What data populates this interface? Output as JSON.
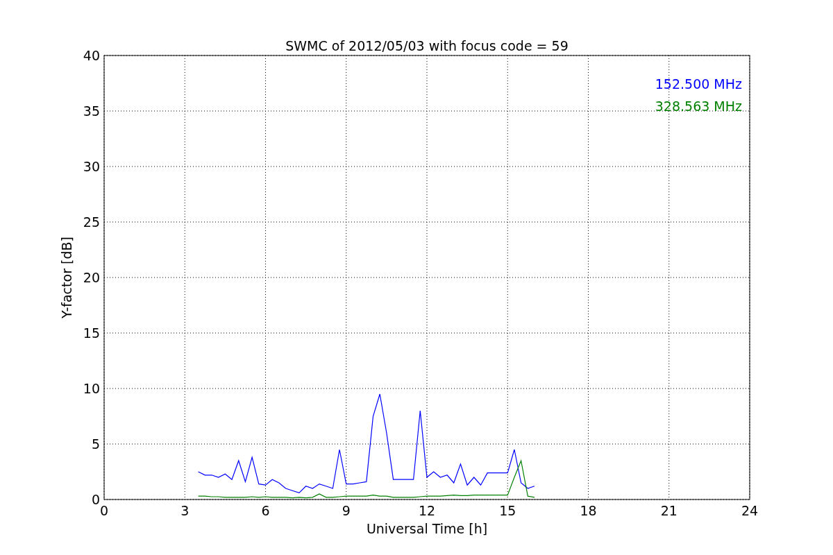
{
  "chart_data": {
    "type": "line",
    "title": "SWMC of 2012/05/03 with focus code = 59",
    "xlabel": "Universal Time [h]",
    "ylabel": "Y-factor [dB]",
    "x": [
      3.5,
      3.75,
      4.0,
      4.25,
      4.5,
      4.75,
      5.0,
      5.25,
      5.5,
      5.75,
      6.0,
      6.25,
      6.5,
      6.75,
      7.0,
      7.25,
      7.5,
      7.75,
      8.0,
      8.25,
      8.5,
      8.75,
      9.0,
      9.25,
      9.5,
      9.75,
      10.0,
      10.25,
      10.5,
      10.75,
      11.0,
      11.25,
      11.5,
      11.75,
      12.0,
      12.25,
      12.5,
      12.75,
      13.0,
      13.25,
      13.5,
      13.75,
      14.0,
      14.25,
      14.5,
      14.75,
      15.0,
      15.25,
      15.5,
      15.75,
      16.0
    ],
    "series": [
      {
        "name": "152.500 MHz",
        "color": "#0000ff",
        "values": [
          2.5,
          2.2,
          2.2,
          2.0,
          2.3,
          1.8,
          3.5,
          1.6,
          3.8,
          1.4,
          1.3,
          1.8,
          1.5,
          1.0,
          0.8,
          0.6,
          1.2,
          1.0,
          1.4,
          1.2,
          1.0,
          4.5,
          1.4,
          1.4,
          1.5,
          1.6,
          7.5,
          9.5,
          6.0,
          1.8,
          1.8,
          1.8,
          1.8,
          8.0,
          2.0,
          2.5,
          2.0,
          2.2,
          1.5,
          3.2,
          1.3,
          2.0,
          1.3,
          2.4,
          2.4,
          2.4,
          2.4,
          4.5,
          1.5,
          1.0,
          1.2
        ]
      },
      {
        "name": "328.563 MHz",
        "color": "#008000",
        "values": [
          0.3,
          0.3,
          0.25,
          0.25,
          0.2,
          0.2,
          0.2,
          0.2,
          0.25,
          0.2,
          0.25,
          0.2,
          0.2,
          0.2,
          0.15,
          0.2,
          0.15,
          0.2,
          0.5,
          0.2,
          0.2,
          0.25,
          0.3,
          0.3,
          0.3,
          0.3,
          0.4,
          0.3,
          0.3,
          0.2,
          0.2,
          0.2,
          0.2,
          0.25,
          0.3,
          0.3,
          0.3,
          0.35,
          0.4,
          0.35,
          0.35,
          0.4,
          0.4,
          0.4,
          0.4,
          0.4,
          0.4,
          2.0,
          3.5,
          0.3,
          0.2
        ]
      }
    ],
    "grid": true,
    "xlim": [
      0,
      24
    ],
    "ylim": [
      0,
      40
    ],
    "xticks": [
      0,
      3,
      6,
      9,
      12,
      15,
      18,
      21,
      24
    ],
    "yticks": [
      0,
      5,
      10,
      15,
      20,
      25,
      30,
      35,
      40
    ]
  }
}
